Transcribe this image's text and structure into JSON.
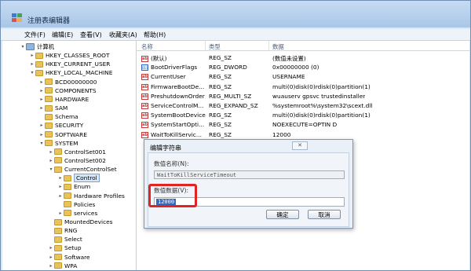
{
  "window": {
    "title": "注册表编辑器"
  },
  "menu": [
    "文件(F)",
    "编辑(E)",
    "查看(V)",
    "收藏夹(A)",
    "帮助(H)"
  ],
  "tree": [
    {
      "label": "计算机",
      "depth": 0,
      "toggle": "▾",
      "icon": "computer"
    },
    {
      "label": "HKEY_CLASSES_ROOT",
      "depth": 1,
      "toggle": "▸",
      "icon": "folder"
    },
    {
      "label": "HKEY_CURRENT_USER",
      "depth": 1,
      "toggle": "▸",
      "icon": "folder"
    },
    {
      "label": "HKEY_LOCAL_MACHINE",
      "depth": 1,
      "toggle": "▾",
      "icon": "folder"
    },
    {
      "label": "BCD00000000",
      "depth": 2,
      "toggle": "▸",
      "icon": "folder"
    },
    {
      "label": "COMPONENTS",
      "depth": 2,
      "toggle": "▸",
      "icon": "folder"
    },
    {
      "label": "HARDWARE",
      "depth": 2,
      "toggle": "▸",
      "icon": "folder"
    },
    {
      "label": "SAM",
      "depth": 2,
      "toggle": "▸",
      "icon": "folder"
    },
    {
      "label": "Schema",
      "depth": 2,
      "toggle": "",
      "icon": "folder"
    },
    {
      "label": "SECURITY",
      "depth": 2,
      "toggle": "▸",
      "icon": "folder"
    },
    {
      "label": "SOFTWARE",
      "depth": 2,
      "toggle": "▸",
      "icon": "folder"
    },
    {
      "label": "SYSTEM",
      "depth": 2,
      "toggle": "▾",
      "icon": "folder"
    },
    {
      "label": "ControlSet001",
      "depth": 3,
      "toggle": "▸",
      "icon": "folder"
    },
    {
      "label": "ControlSet002",
      "depth": 3,
      "toggle": "▸",
      "icon": "folder"
    },
    {
      "label": "CurrentControlSet",
      "depth": 3,
      "toggle": "▾",
      "icon": "folder"
    },
    {
      "label": "Control",
      "depth": 4,
      "toggle": "▸",
      "icon": "folder",
      "selected": true
    },
    {
      "label": "Enum",
      "depth": 4,
      "toggle": "▸",
      "icon": "folder"
    },
    {
      "label": "Hardware Profiles",
      "depth": 4,
      "toggle": "▸",
      "icon": "folder"
    },
    {
      "label": "Policies",
      "depth": 4,
      "toggle": "",
      "icon": "folder"
    },
    {
      "label": "services",
      "depth": 4,
      "toggle": "▸",
      "icon": "folder"
    },
    {
      "label": "MountedDevices",
      "depth": 3,
      "toggle": "",
      "icon": "folder"
    },
    {
      "label": "RNG",
      "depth": 3,
      "toggle": "",
      "icon": "folder"
    },
    {
      "label": "Select",
      "depth": 3,
      "toggle": "",
      "icon": "folder"
    },
    {
      "label": "Setup",
      "depth": 3,
      "toggle": "▸",
      "icon": "folder"
    },
    {
      "label": "Software",
      "depth": 3,
      "toggle": "▸",
      "icon": "folder"
    },
    {
      "label": "WPA",
      "depth": 3,
      "toggle": "▸",
      "icon": "folder"
    }
  ],
  "columns": {
    "name": "名称",
    "type": "类型",
    "data": "数据"
  },
  "values": [
    {
      "name": "(默认)",
      "type": "REG_SZ",
      "data": "(数值未设置)",
      "kind": "ab"
    },
    {
      "name": "BootDriverFlags",
      "type": "REG_DWORD",
      "data": "0x00000000 (0)",
      "kind": "bin"
    },
    {
      "name": "CurrentUser",
      "type": "REG_SZ",
      "data": "USERNAME",
      "kind": "ab"
    },
    {
      "name": "FirmwareBootDe...",
      "type": "REG_SZ",
      "data": "multi(0)disk(0)rdisk(0)partition(1)",
      "kind": "ab"
    },
    {
      "name": "PreshutdownOrder",
      "type": "REG_MULTI_SZ",
      "data": "wuauserv gpsvc trustedinstaller",
      "kind": "ab"
    },
    {
      "name": "ServiceControlM...",
      "type": "REG_EXPAND_SZ",
      "data": "%systemroot%\\system32\\scext.dll",
      "kind": "ab"
    },
    {
      "name": "SystemBootDevice",
      "type": "REG_SZ",
      "data": "multi(0)disk(0)rdisk(0)partition(1)",
      "kind": "ab"
    },
    {
      "name": "SystemStartOpti...",
      "type": "REG_SZ",
      "data": " NOEXECUTE=OPTIN D",
      "kind": "ab"
    },
    {
      "name": "WaitToKillServic...",
      "type": "REG_SZ",
      "data": "12000",
      "kind": "ab"
    }
  ],
  "dialog": {
    "title": "编辑字符串",
    "close": "✕",
    "name_label": "数值名称(N):",
    "name_value": "WaitToKillServiceTimeout",
    "data_label": "数值数据(V):",
    "data_value": "12000",
    "ok": "确定",
    "cancel": "取消"
  },
  "colors": {
    "highlight": "#e02323",
    "selection": "#2f6ac6"
  }
}
